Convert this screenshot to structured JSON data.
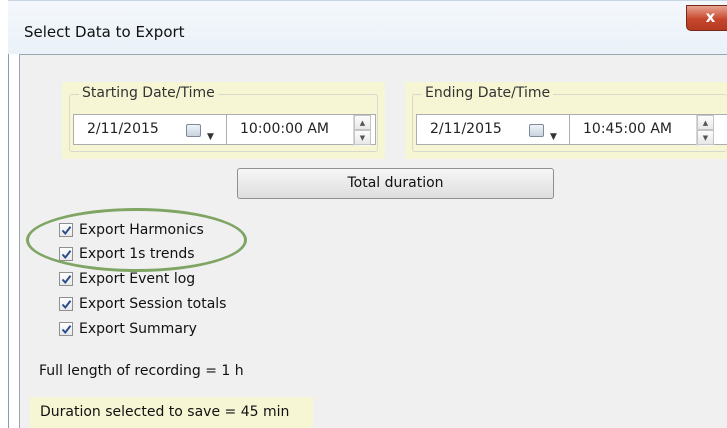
{
  "window": {
    "title": "Select Data to Export",
    "close_glyph": "x"
  },
  "start": {
    "label": "Starting Date/Time",
    "date": "2/11/2015",
    "time": "10:00:00 AM"
  },
  "end": {
    "label": "Ending Date/Time",
    "date": "2/11/2015",
    "time": "10:45:00 AM"
  },
  "total_duration_button": "Total duration",
  "exports": [
    {
      "label": "Export Harmonics",
      "checked": true
    },
    {
      "label": "Export 1s trends",
      "checked": true
    },
    {
      "label": "Export Event log",
      "checked": true
    },
    {
      "label": "Export Session totals",
      "checked": true
    },
    {
      "label": "Export Summary",
      "checked": true
    }
  ],
  "full_length": "Full length of recording = 1 h",
  "duration_selected": "Duration selected to save = 45 min",
  "colors": {
    "highlight": "#f6f6d4",
    "annotation_ellipse": "#7fa564",
    "close_button": "#c7472d"
  },
  "icons": {
    "calendar": "calendar-icon",
    "dropdown": "chevron-down-icon",
    "spin_up": "spin-up-icon",
    "spin_down": "spin-down-icon",
    "checkmark": "checkmark-icon"
  }
}
